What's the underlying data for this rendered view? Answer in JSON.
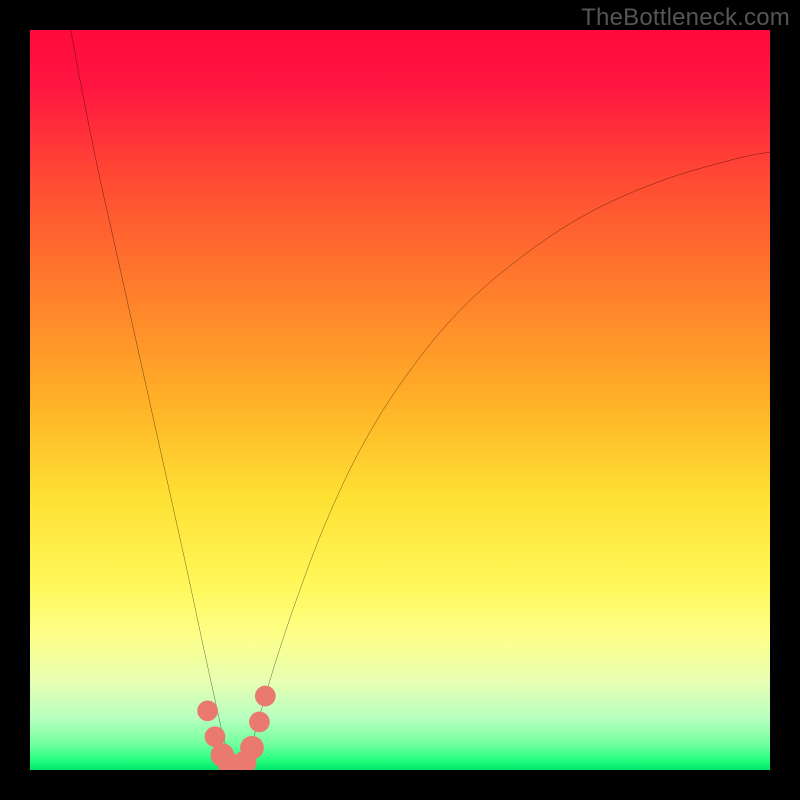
{
  "watermark": "TheBottleneck.com",
  "chart_data": {
    "type": "line",
    "title": "",
    "xlabel": "",
    "ylabel": "",
    "xlim": [
      0,
      100
    ],
    "ylim": [
      0,
      100
    ],
    "gradient_stops": [
      {
        "offset": 0,
        "color": "#ff0a3a"
      },
      {
        "offset": 0.08,
        "color": "#ff1740"
      },
      {
        "offset": 0.2,
        "color": "#ff4a33"
      },
      {
        "offset": 0.35,
        "color": "#ff7d2c"
      },
      {
        "offset": 0.5,
        "color": "#ffb027"
      },
      {
        "offset": 0.63,
        "color": "#ffe033"
      },
      {
        "offset": 0.75,
        "color": "#fff85a"
      },
      {
        "offset": 0.82,
        "color": "#fdff8a"
      },
      {
        "offset": 0.88,
        "color": "#e7ffb2"
      },
      {
        "offset": 0.93,
        "color": "#b8ffc0"
      },
      {
        "offset": 0.965,
        "color": "#72ff9e"
      },
      {
        "offset": 0.985,
        "color": "#2aff82"
      },
      {
        "offset": 1.0,
        "color": "#00e86a"
      }
    ],
    "series": [
      {
        "name": "left-branch",
        "x": [
          5.5,
          7.0,
          9.0,
          11.0,
          13.0,
          15.0,
          17.0,
          19.0,
          21.0,
          22.5,
          24.0,
          25.0,
          26.0,
          26.8,
          27.5
        ],
        "y": [
          100,
          92,
          82,
          73,
          64,
          55,
          46,
          37,
          28,
          21,
          14,
          9.5,
          5.0,
          2.3,
          0.6
        ]
      },
      {
        "name": "right-branch",
        "x": [
          29.0,
          30.0,
          31.0,
          33.0,
          36.0,
          40.0,
          45.0,
          51.0,
          58.0,
          66.0,
          75.0,
          85.0,
          95.0,
          100.0
        ],
        "y": [
          0.6,
          3.6,
          7.2,
          14.0,
          23.0,
          33.5,
          44.0,
          53.5,
          62.0,
          69.0,
          75.0,
          79.5,
          82.5,
          83.5
        ]
      }
    ],
    "markers": {
      "name": "bottom-cluster",
      "color": "#ea7a70",
      "points": [
        {
          "x": 24.0,
          "y": 8.0,
          "r": 1.4
        },
        {
          "x": 25.0,
          "y": 4.5,
          "r": 1.4
        },
        {
          "x": 26.0,
          "y": 2.0,
          "r": 1.6
        },
        {
          "x": 27.0,
          "y": 0.7,
          "r": 1.6
        },
        {
          "x": 28.0,
          "y": 0.4,
          "r": 1.6
        },
        {
          "x": 29.0,
          "y": 1.0,
          "r": 1.6
        },
        {
          "x": 30.0,
          "y": 3.0,
          "r": 1.6
        },
        {
          "x": 31.0,
          "y": 6.5,
          "r": 1.4
        },
        {
          "x": 31.8,
          "y": 10.0,
          "r": 1.4
        }
      ]
    },
    "curve_stroke": "#000000",
    "curve_width": 2.2
  }
}
